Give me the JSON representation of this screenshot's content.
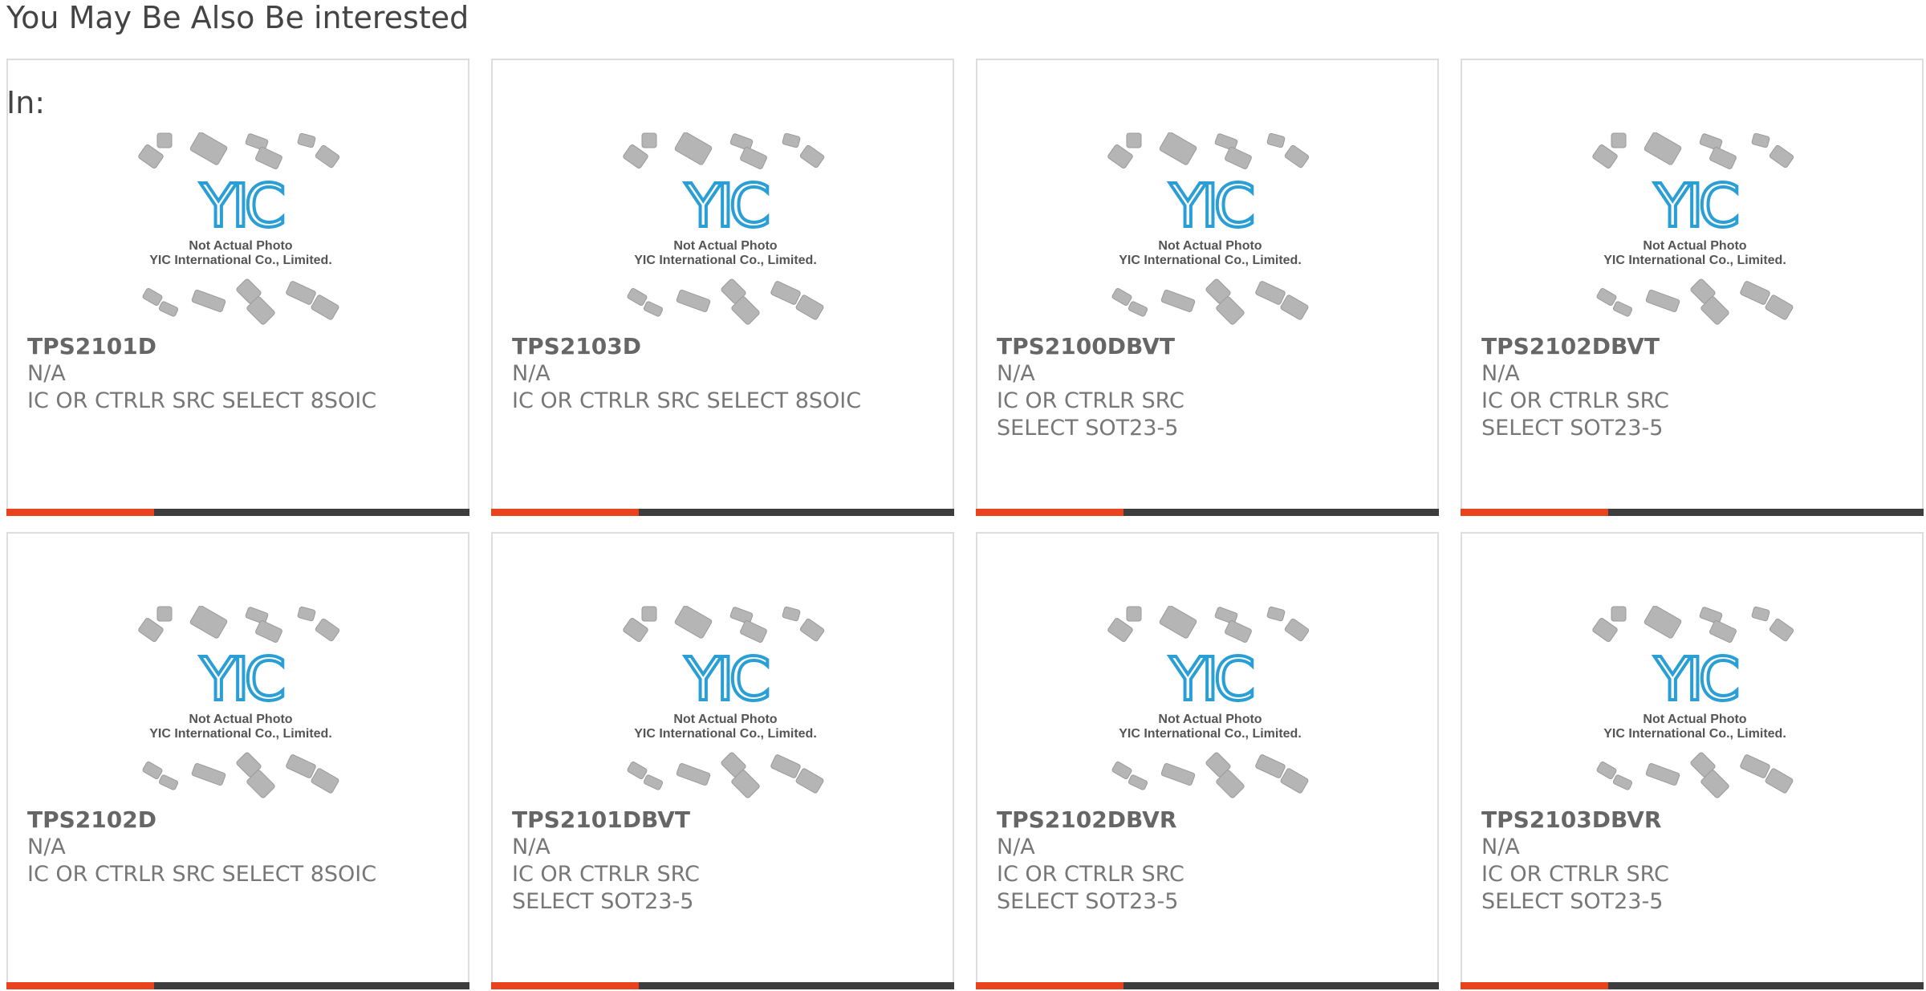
{
  "section": {
    "title_line1": "You May Be Also Be interested",
    "title_line2": "In:"
  },
  "thumbnail": {
    "logo_text": "YIC",
    "caption_line1": "Not Actual Photo",
    "caption_line2": "YIC International Co., Limited.",
    "logo_color": "#2a9fd6",
    "chip_color": "#b5b5b5"
  },
  "colors": {
    "accent": "#e8431c",
    "bar": "#3d3d3d",
    "border": "#dddddd",
    "text": "#666666"
  },
  "products": [
    {
      "part_number": "TPS2101D",
      "manufacturer": "N/A",
      "description": "IC OR CTRLR SRC SELECT 8SOIC"
    },
    {
      "part_number": "TPS2103D",
      "manufacturer": "N/A",
      "description": "IC OR CTRLR SRC SELECT 8SOIC"
    },
    {
      "part_number": "TPS2100DBVT",
      "manufacturer": "N/A",
      "description": "IC OR CTRLR SRC SELECT SOT23-5"
    },
    {
      "part_number": "TPS2102DBVT",
      "manufacturer": "N/A",
      "description": "IC OR CTRLR SRC SELECT SOT23-5"
    },
    {
      "part_number": "TPS2102D",
      "manufacturer": "N/A",
      "description": "IC OR CTRLR SRC SELECT 8SOIC"
    },
    {
      "part_number": "TPS2101DBVT",
      "manufacturer": "N/A",
      "description": "IC OR CTRLR SRC SELECT SOT23-5"
    },
    {
      "part_number": "TPS2102DBVR",
      "manufacturer": "N/A",
      "description": "IC OR CTRLR SRC SELECT SOT23-5"
    },
    {
      "part_number": "TPS2103DBVR",
      "manufacturer": "N/A",
      "description": "IC OR CTRLR SRC SELECT SOT23-5"
    }
  ]
}
